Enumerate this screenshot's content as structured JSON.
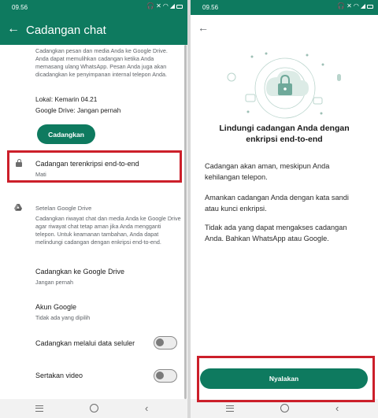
{
  "left": {
    "status": {
      "time": "09.56"
    },
    "appbar": {
      "title": "Cadangan chat"
    },
    "backup_description": "Cadangkan pesan dan media Anda ke Google Drive. Anda dapat memulihkan cadangan ketika Anda memasang ulang WhatsApp. Pesan Anda juga akan dicadangkan ke penyimpanan internal telepon Anda.",
    "local_label": "Lokal: Kemarin 04.21",
    "gdrive_label": "Google Drive: Jangan pernah",
    "backup_button": "Cadangkan",
    "encrypted": {
      "title": "Cadangan terenkripsi end-to-end",
      "subtitle": "Mati"
    },
    "google_drive_settings": {
      "header": "Setelan Google Drive",
      "description": "Cadangkan riwayat chat dan media Anda ke Google Drive agar riwayat chat tetap aman jika Anda mengganti telepon. Untuk keamanan tambahan, Anda dapat melindungi cadangan dengan enkripsi end-to-end."
    },
    "rows": {
      "backup_to_drive": {
        "title": "Cadangkan ke Google Drive",
        "subtitle": "Jangan pernah"
      },
      "google_account": {
        "title": "Akun Google",
        "subtitle": "Tidak ada yang dipilih"
      },
      "cellular": {
        "title": "Cadangkan melalui data seluler",
        "enabled": false
      },
      "include_video": {
        "title": "Sertakan video",
        "enabled": false
      }
    }
  },
  "right": {
    "status": {
      "time": "09.56"
    },
    "title": "Lindungi cadangan Anda dengan enkripsi end-to-end",
    "paragraphs": [
      "Cadangan akan aman, meskipun Anda kehilangan telepon.",
      "Amankan cadangan Anda dengan kata sandi atau kunci enkripsi.",
      "Tidak ada yang dapat mengakses cadangan Anda. Bahkan WhatsApp atau Google."
    ],
    "button": "Nyalakan"
  },
  "colors": {
    "primary": "#0e7a5f",
    "highlight": "#cc1f2a",
    "illustration": "#6fa99a"
  },
  "icons": [
    "back-arrow-icon",
    "lock-icon",
    "google-drive-icon",
    "cloud-lock-icon",
    "headphones-icon",
    "mute-icon",
    "wifi-icon",
    "signal-icon",
    "battery-icon"
  ]
}
